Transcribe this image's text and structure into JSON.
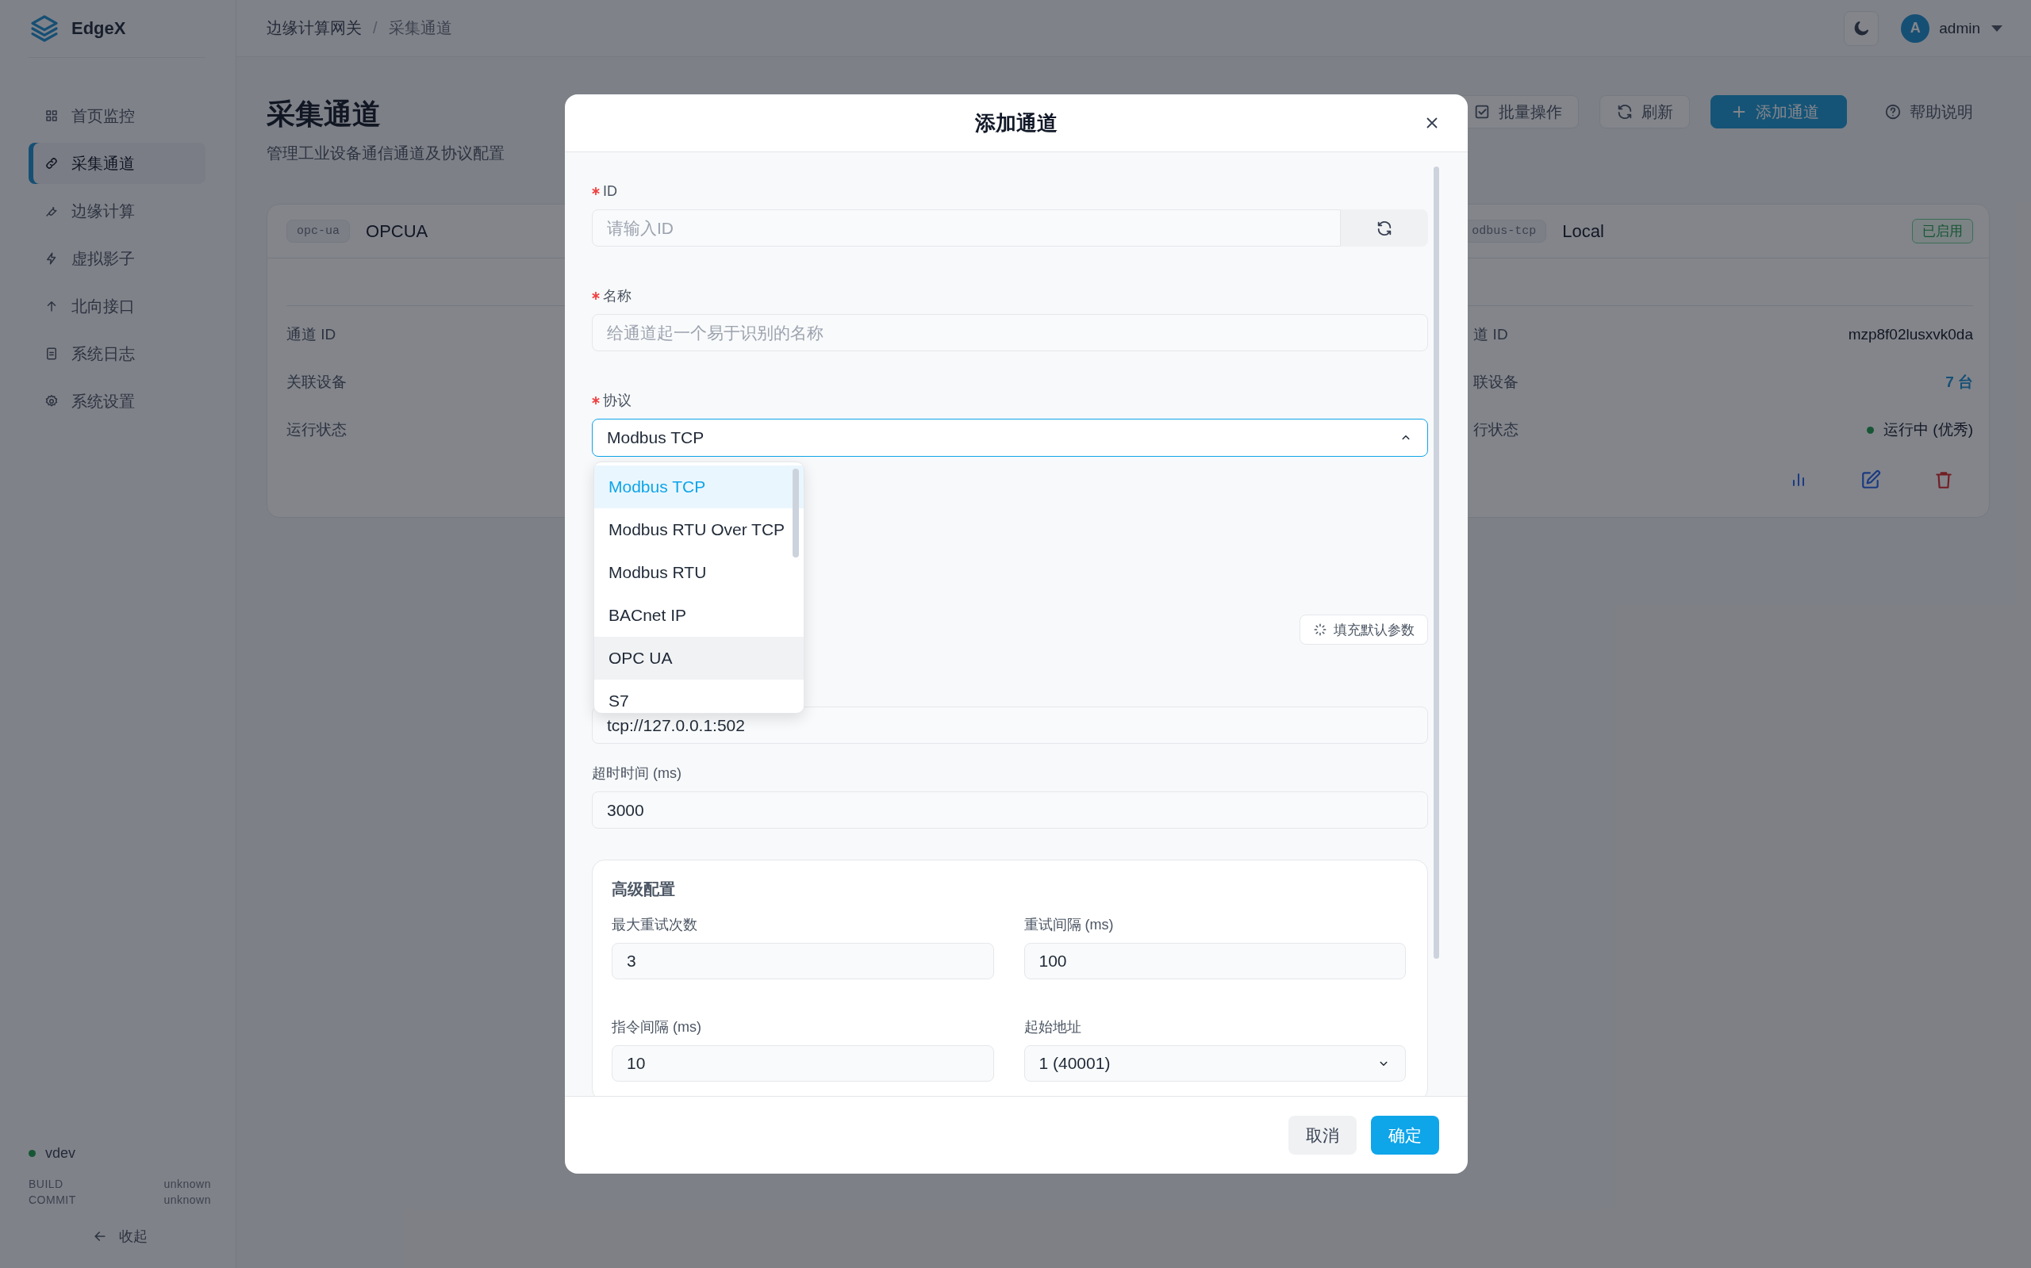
{
  "sidebar": {
    "brand": "EdgeX",
    "items": [
      {
        "label": "首页监控",
        "selected": false
      },
      {
        "label": "采集通道",
        "selected": true
      },
      {
        "label": "边缘计算",
        "selected": false
      },
      {
        "label": "虚拟影子",
        "selected": false
      },
      {
        "label": "北向接口",
        "selected": false
      },
      {
        "label": "系统日志",
        "selected": false
      },
      {
        "label": "系统设置",
        "selected": false
      }
    ],
    "version": "vdev",
    "build": {
      "label": "BUILD",
      "value": "unknown"
    },
    "commit": {
      "label": "COMMIT",
      "value": "unknown"
    },
    "collapse": "收起"
  },
  "header": {
    "breadcrumb": [
      "边缘计算网关",
      "采集通道"
    ],
    "separator": "/",
    "user": {
      "avatar": "A",
      "name": "admin"
    }
  },
  "page": {
    "title": "采集通道",
    "subtitle": "管理工业设备通信通道及协议配置",
    "toolbar": [
      {
        "label": "批量操作",
        "kind": "default"
      },
      {
        "label": "刷新",
        "kind": "default"
      },
      {
        "label": "添加通道",
        "kind": "primary"
      },
      {
        "label": "帮助说明",
        "kind": "link"
      }
    ]
  },
  "cards": [
    {
      "tag": "opc-ua",
      "name": "OPCUA",
      "rows": [
        {
          "label": "通道 ID"
        },
        {
          "label": "关联设备"
        },
        {
          "label": "运行状态"
        }
      ]
    },
    {
      "tag": "odbus-tcp",
      "name": "Local",
      "status": "已启用",
      "rows": [
        {
          "label": "道 ID",
          "value": "mzp8f02lusxvk0da",
          "kind": "text"
        },
        {
          "label": "联设备",
          "value": "7 台",
          "kind": "link"
        },
        {
          "label": "行状态",
          "value": "运行中 (优秀)",
          "kind": "status"
        }
      ]
    }
  ],
  "dialog": {
    "title": "添加通道",
    "fields": [
      {
        "kind": "input_regen",
        "label": "ID",
        "required": true,
        "placeholder": "请输入ID"
      },
      {
        "kind": "input",
        "label": "名称",
        "required": true,
        "placeholder": "给通道起一个易于识别的名称"
      },
      {
        "kind": "select",
        "label": "协议",
        "required": true,
        "value": "Modbus TCP",
        "expanded": true
      }
    ],
    "protocol_options": [
      {
        "label": "Modbus TCP",
        "selected": true,
        "hovered": false
      },
      {
        "label": "Modbus RTU Over TCP",
        "selected": false,
        "hovered": false
      },
      {
        "label": "Modbus RTU",
        "selected": false,
        "hovered": false
      },
      {
        "label": "BACnet IP",
        "selected": false,
        "hovered": false
      },
      {
        "label": "OPC UA",
        "selected": false,
        "hovered": true
      },
      {
        "label": "S7",
        "selected": false,
        "hovered": false
      }
    ],
    "fill_button": "填充默认参数",
    "address": {
      "value": "tcp://127.0.0.1:502"
    },
    "timeout": {
      "label": "超时时间 (ms)",
      "value": "3000"
    },
    "advanced": {
      "title": "高级配置",
      "fields": [
        {
          "kind": "input",
          "label": "最大重试次数",
          "value": "3"
        },
        {
          "kind": "input",
          "label": "重试间隔 (ms)",
          "value": "100"
        },
        {
          "kind": "input",
          "label": "指令间隔 (ms)",
          "value": "10"
        },
        {
          "kind": "select",
          "label": "起始地址",
          "value": "1 (40001)",
          "expanded": false
        }
      ]
    },
    "buttons": [
      {
        "label": "取消",
        "kind": "secondary"
      },
      {
        "label": "确定",
        "kind": "primary"
      }
    ]
  }
}
